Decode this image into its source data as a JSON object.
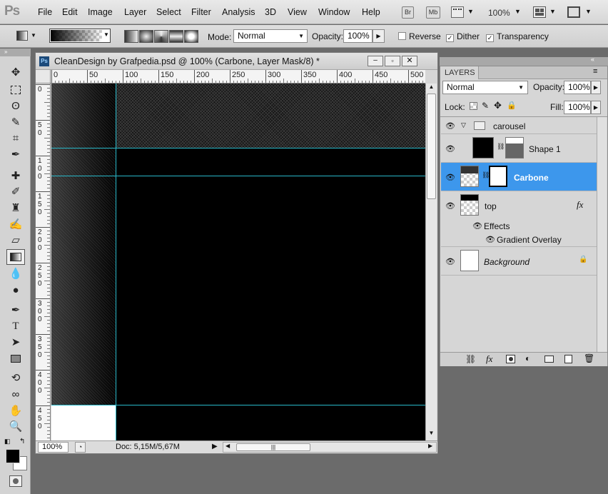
{
  "app": {
    "logo": "Ps",
    "bridge_label": "Br",
    "minibridge_label": "Mb",
    "zoom": "100%"
  },
  "menu": [
    "File",
    "Edit",
    "Image",
    "Layer",
    "Select",
    "Filter",
    "Analysis",
    "3D",
    "View",
    "Window",
    "Help"
  ],
  "options": {
    "mode_label": "Mode:",
    "mode_value": "Normal",
    "opacity_label": "Opacity:",
    "opacity_value": "100%",
    "reverse_label": "Reverse",
    "reverse_checked": false,
    "dither_label": "Dither",
    "dither_checked": true,
    "transparency_label": "Transparency",
    "transparency_checked": true
  },
  "document": {
    "title": "CleanDesign by Grafpedia.psd @ 100% (Carbone, Layer Mask/8) *",
    "ruler_h": [
      "0",
      "50",
      "100",
      "150",
      "200",
      "250",
      "300",
      "350",
      "400",
      "450",
      "500"
    ],
    "ruler_v": [
      "0",
      "5\n0",
      "1\n0\n0",
      "1\n5\n0",
      "2\n0\n0",
      "2\n5\n0",
      "3\n0\n0",
      "3\n5\n0",
      "4\n0\n0",
      "4\n5\n0"
    ],
    "status_zoom": "100%",
    "status_doc": "Doc: 5,15M/5,67M"
  },
  "layers_panel": {
    "title": "LAYERS",
    "blend_mode": "Normal",
    "opacity_label": "Opacity:",
    "opacity_value": "100%",
    "lock_label": "Lock:",
    "fill_label": "Fill:",
    "fill_value": "100%",
    "layers": [
      {
        "name": "carousel",
        "type": "group"
      },
      {
        "name": "Shape 1",
        "type": "shape"
      },
      {
        "name": "Carbone",
        "type": "masked",
        "selected": true
      },
      {
        "name": "top",
        "type": "fx",
        "fx_label": "fx"
      },
      {
        "name": "Effects",
        "type": "effects"
      },
      {
        "name": "Gradient Overlay",
        "type": "effect"
      },
      {
        "name": "Background",
        "type": "background"
      }
    ]
  },
  "colors": {
    "selection": "#3d97ec",
    "guide": "#29b8c9"
  }
}
